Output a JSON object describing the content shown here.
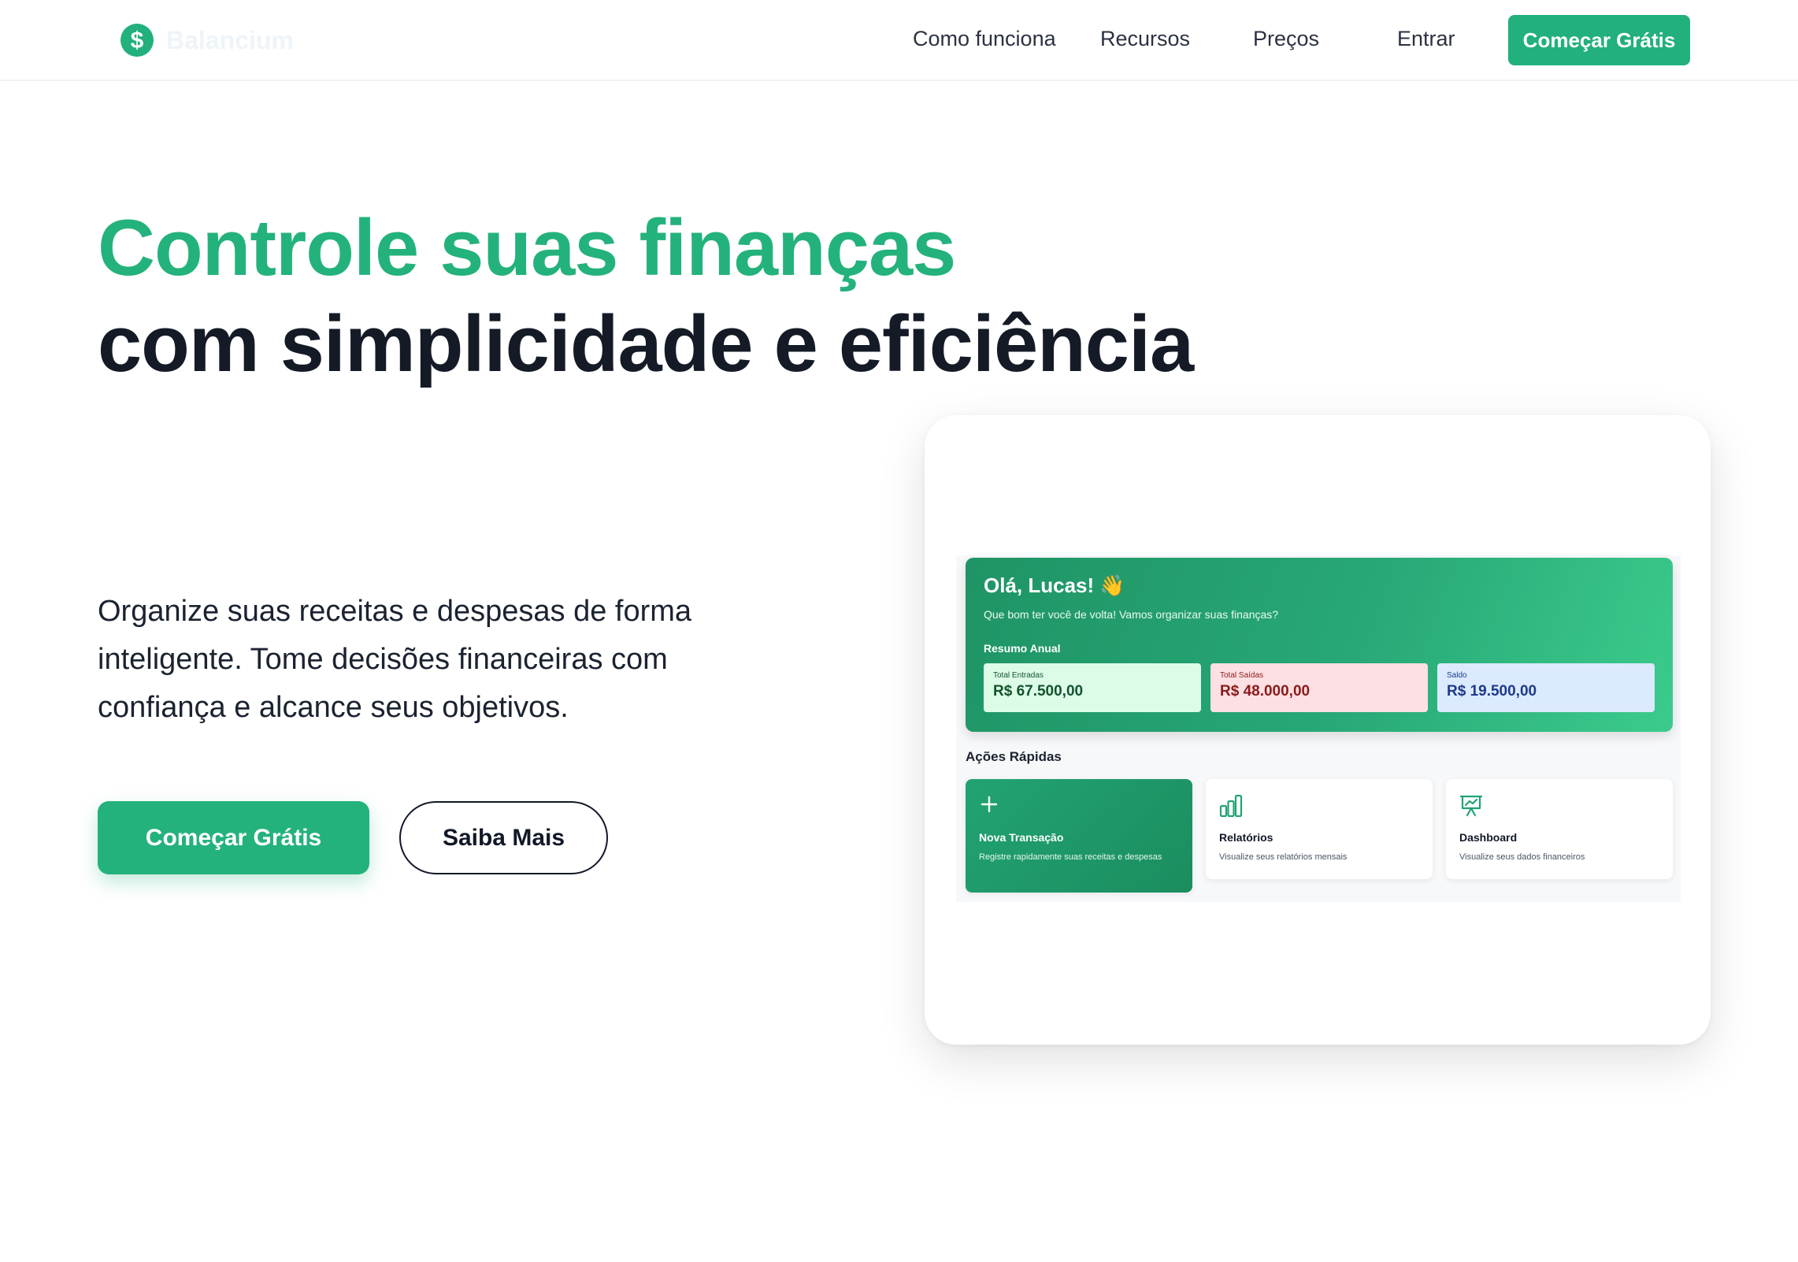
{
  "nav": {
    "brand": "Balancium",
    "links": [
      "Como funciona",
      "Recursos",
      "Preços",
      "Entrar"
    ],
    "cta": "Começar Grátis"
  },
  "hero": {
    "title_line1": "Controle suas finanças",
    "title_line2": "com simplicidade e eficiência",
    "subtitle": "Organize suas receitas e despesas de forma inteligente. Tome decisões financeiras com confiança e alcance seus objetivos.",
    "primary_button": "Começar Grátis",
    "secondary_button": "Saiba Mais"
  },
  "preview": {
    "greeting": "Olá, Lucas! 👋",
    "greeting_sub": "Que bom ter você de volta! Vamos organizar suas finanças?",
    "summary_title": "Resumo Anual",
    "stats": [
      {
        "label": "Total Entradas",
        "value": "R$ 67.500,00"
      },
      {
        "label": "Total Saídas",
        "value": "R$ 48.000,00"
      },
      {
        "label": "Saldo",
        "value": "R$ 19.500,00"
      }
    ],
    "quick_actions_title": "Ações Rápidas",
    "quick_actions": [
      {
        "title": "Nova Transação",
        "desc": "Registre rapidamente suas receitas e despesas",
        "icon": "plus-icon"
      },
      {
        "title": "Relatórios",
        "desc": "Visualize seus relatórios mensais",
        "icon": "bar-chart-icon"
      },
      {
        "title": "Dashboard",
        "desc": "Visualize seus dados financeiros",
        "icon": "presentation-chart-icon"
      }
    ]
  },
  "colors": {
    "brand_green": "#24b27c",
    "dark_text": "#151b26",
    "income_bg": "#dcfce7",
    "expense_bg": "#fde0e3",
    "balance_bg": "#dbeafe"
  }
}
